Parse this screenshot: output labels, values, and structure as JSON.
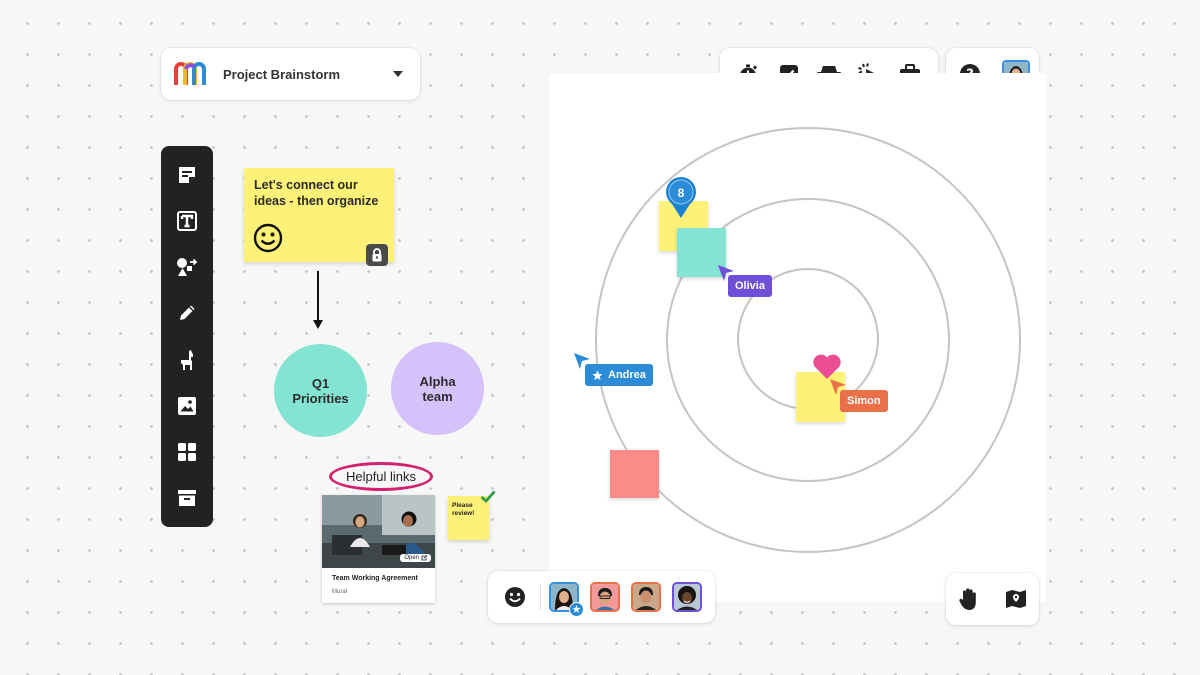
{
  "project": {
    "title": "Project Brainstorm"
  },
  "stickies": {
    "connect_text": "Let's connect our ideas - then organize",
    "review_text": "Please review!"
  },
  "circles": {
    "q1": "Q1 Priorities",
    "alpha": "Alpha team"
  },
  "helpful_links": "Helpful links",
  "link_card": {
    "open_label": "Open",
    "title": "Team Working Agreement",
    "source": "Mural"
  },
  "vote": {
    "count": "8"
  },
  "cursors": {
    "olivia": "Olivia",
    "andrea": "Andrea",
    "simon": "Simon"
  },
  "colors": {
    "sticky_yellow": "#fdf178",
    "teal": "#84e4d4",
    "lavender": "#d6c2fa",
    "coral": "#fb8b88",
    "olivia": "#6f4ed8",
    "andrea": "#2b8bd6",
    "simon": "#ea704a",
    "highlight": "#d3206f"
  },
  "icons": {
    "left_toolbar": [
      "sticky-note-icon",
      "text-icon",
      "shapes-icon",
      "pen-icon",
      "llama-icon",
      "image-icon",
      "templates-icon",
      "archive-icon"
    ],
    "top_toolbar": [
      "timer-icon",
      "voting-icon",
      "private-mode-icon",
      "summon-icon",
      "toolbox-icon"
    ],
    "help": "help-icon",
    "bottom_right": [
      "hand-icon",
      "map-icon"
    ]
  }
}
